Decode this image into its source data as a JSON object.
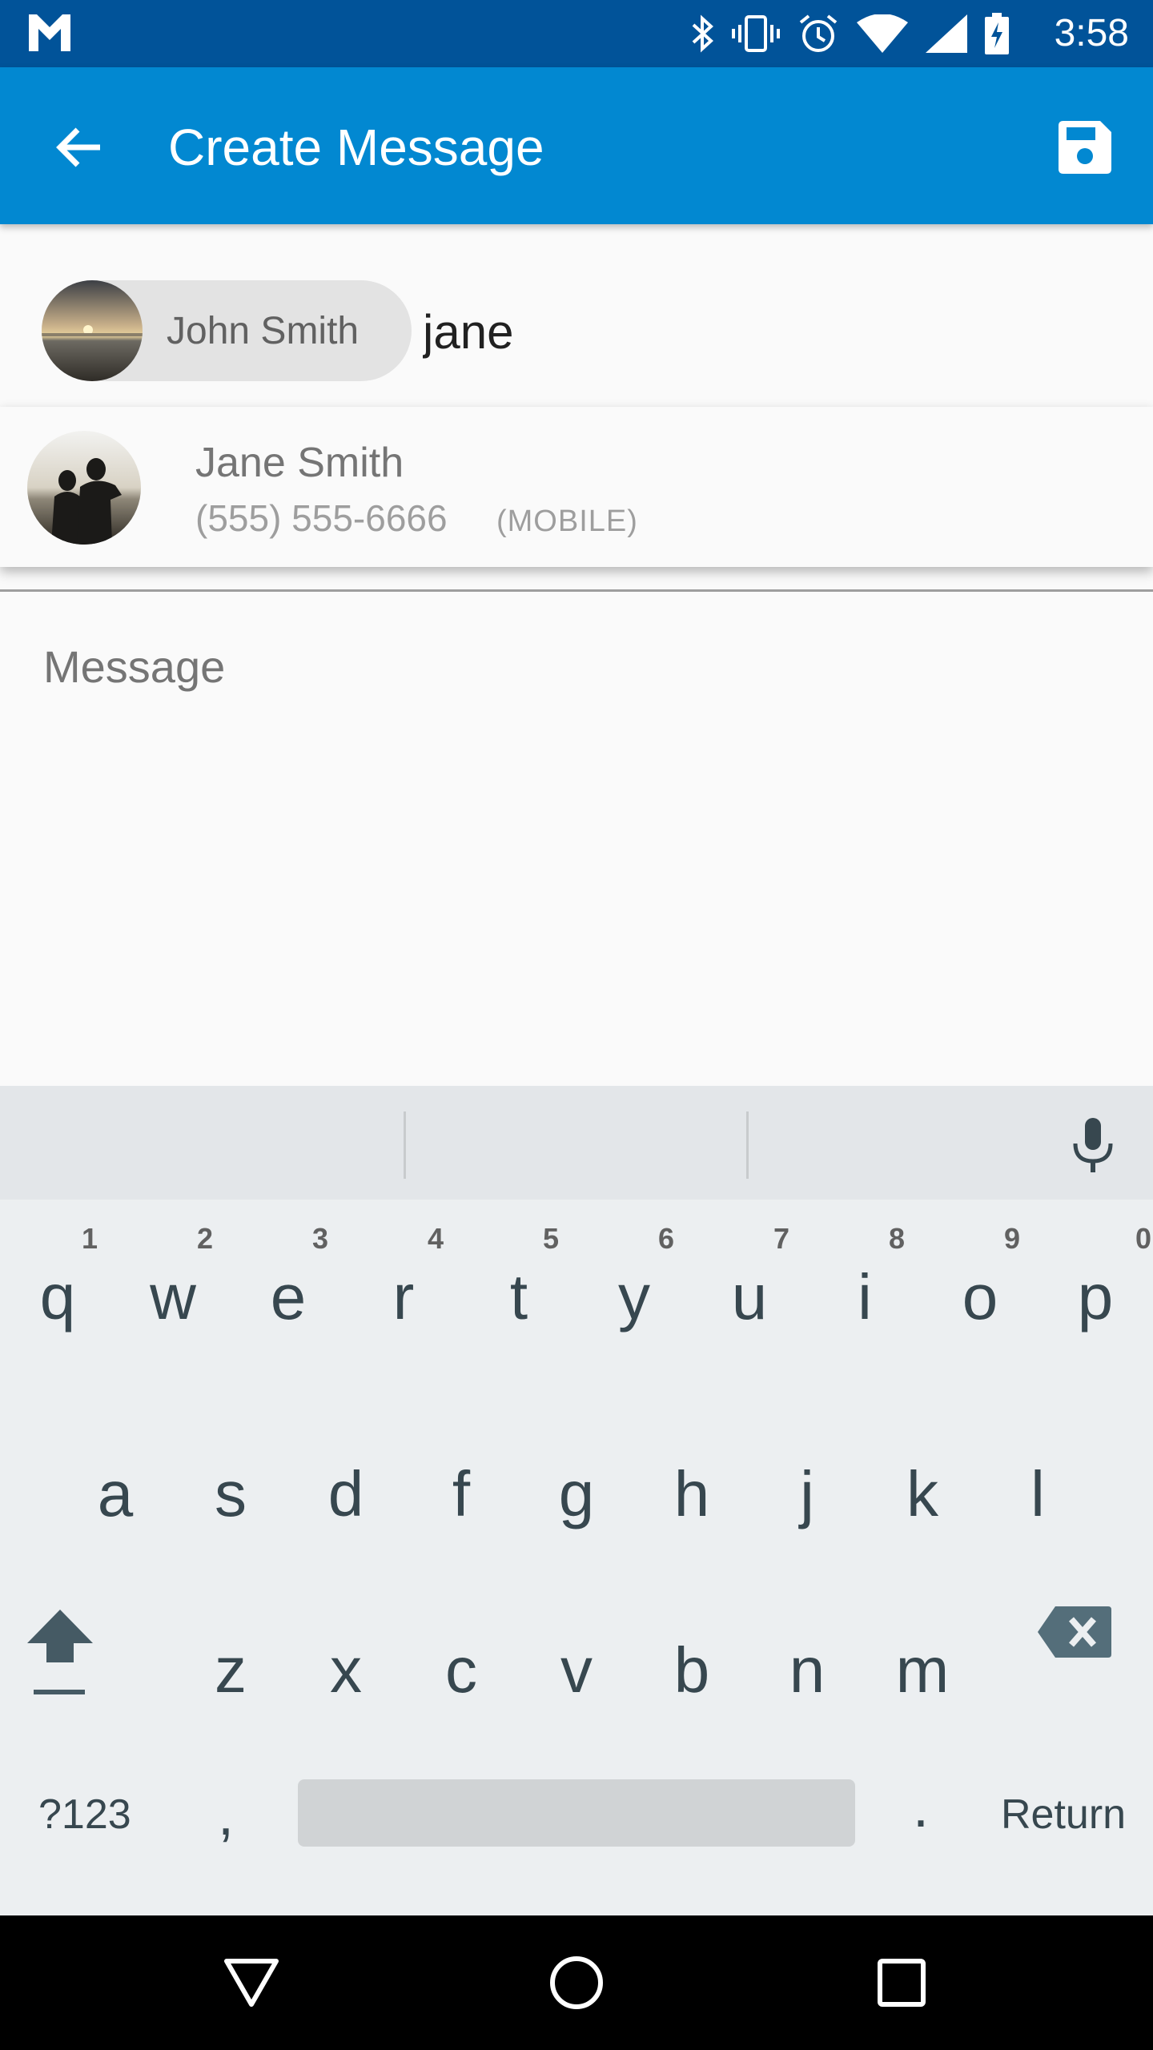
{
  "status_bar": {
    "time": "3:58",
    "icons": [
      "gmail-icon",
      "bluetooth-icon",
      "vibrate-icon",
      "alarm-icon",
      "wifi-icon",
      "signal-icon",
      "battery-charging-icon"
    ]
  },
  "app_bar": {
    "title": "Create Message",
    "back_icon": "arrow-back-icon",
    "save_icon": "save-icon"
  },
  "recipients": {
    "chips": [
      {
        "name": "John Smith"
      }
    ],
    "input_value": "jane"
  },
  "suggestion": {
    "name": "Jane Smith",
    "phone": "(555) 555-6666",
    "phone_type": "(MOBILE)"
  },
  "message": {
    "placeholder": "Message"
  },
  "keyboard": {
    "row1": [
      {
        "key": "q",
        "hint": "1"
      },
      {
        "key": "w",
        "hint": "2"
      },
      {
        "key": "e",
        "hint": "3"
      },
      {
        "key": "r",
        "hint": "4"
      },
      {
        "key": "t",
        "hint": "5"
      },
      {
        "key": "y",
        "hint": "6"
      },
      {
        "key": "u",
        "hint": "7"
      },
      {
        "key": "i",
        "hint": "8"
      },
      {
        "key": "o",
        "hint": "9"
      },
      {
        "key": "p",
        "hint": "0"
      }
    ],
    "row2": [
      "a",
      "s",
      "d",
      "f",
      "g",
      "h",
      "j",
      "k",
      "l"
    ],
    "row3": [
      "z",
      "x",
      "c",
      "v",
      "b",
      "n",
      "m"
    ],
    "symbols_label": "?123",
    "comma": ",",
    "period": ".",
    "return_label": "Return"
  },
  "nav_bar": {
    "icons": [
      "back-triangle-icon",
      "home-circle-icon",
      "recents-square-icon"
    ]
  }
}
